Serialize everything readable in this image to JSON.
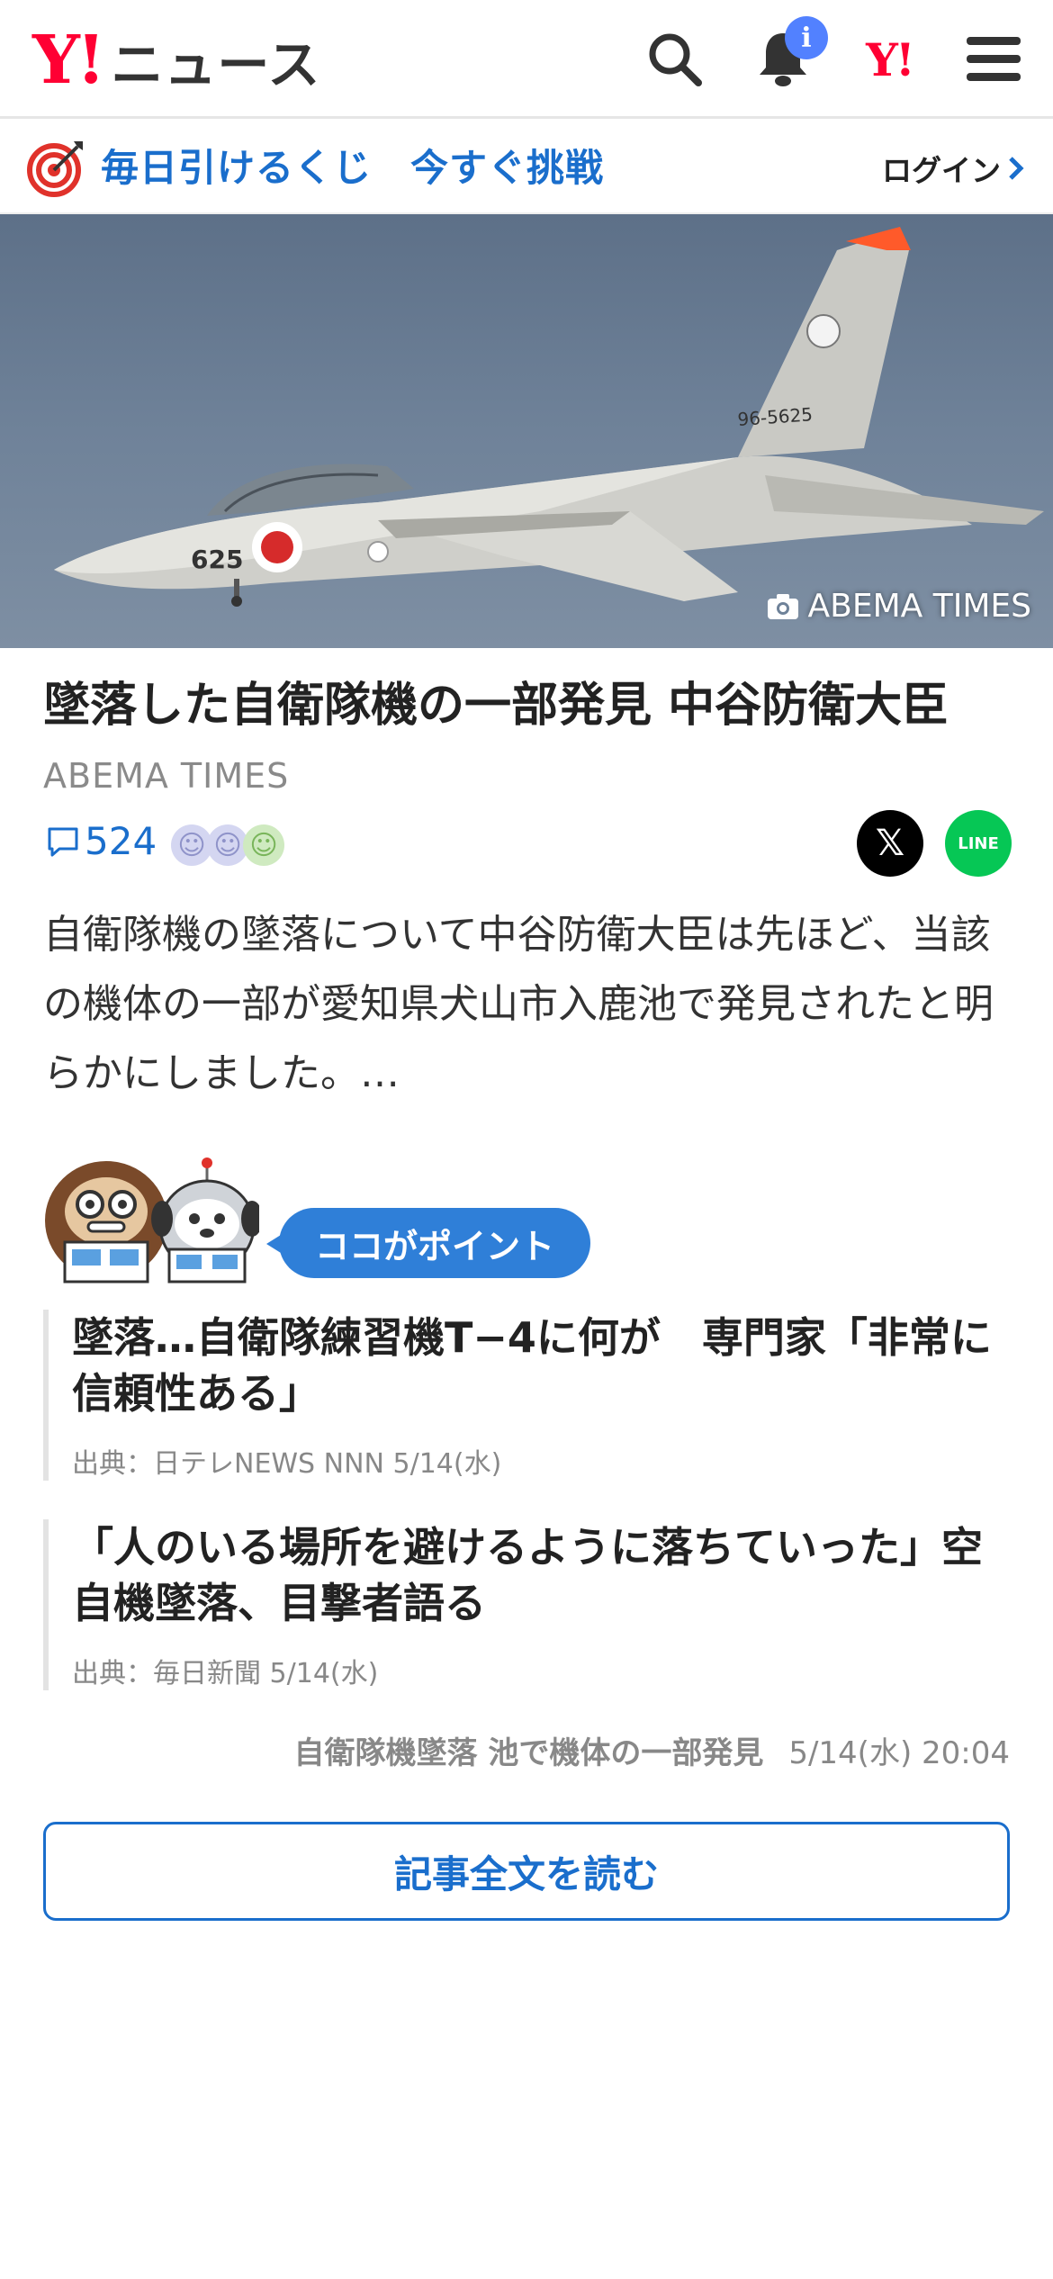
{
  "header": {
    "logo_mark": "Y!",
    "logo_text": "ニュース",
    "notification_badge": "i",
    "yahoo_link": "Y!"
  },
  "promo": {
    "text": "毎日引けるくじ　今すぐ挑戦",
    "login_label": "ログイン"
  },
  "hero": {
    "credit": "ABEMA TIMES",
    "aircraft_tail_number": "96-5625",
    "aircraft_nose_number": "625"
  },
  "article": {
    "title": "墜落した自衛隊機の一部発見 中谷防衛大臣",
    "source": "ABEMA TIMES",
    "comment_count": "524",
    "share_x_label": "𝕏",
    "share_line_label": "LINE",
    "summary": "自衛隊機の墜落について中谷防衛大臣は先ほど、当該の機体の一部が愛知県犬山市入鹿池で発見されたと明らかにしました。…"
  },
  "point": {
    "label": "ココがポイント"
  },
  "related": [
    {
      "title": "墜落…自衛隊練習機T−4に何が　専門家「非常に信頼性ある」",
      "meta": "出典：日テレNEWS NNN 5/14(水)"
    },
    {
      "title": "「人のいる場所を避けるように落ちていった」空自機墜落、目撃者語る",
      "meta": "出典：毎日新聞 5/14(水)"
    }
  ],
  "footer": {
    "topic": "自衛隊機墜落 池で機体の一部発見",
    "timestamp": "5/14(水) 20:04",
    "read_button": "記事全文を読む"
  },
  "colors": {
    "brand_red": "#ff0033",
    "link_blue": "#1a6ecc",
    "point_blue": "#2f7fd8",
    "badge_blue": "#5281ff",
    "line_green": "#06c755"
  }
}
